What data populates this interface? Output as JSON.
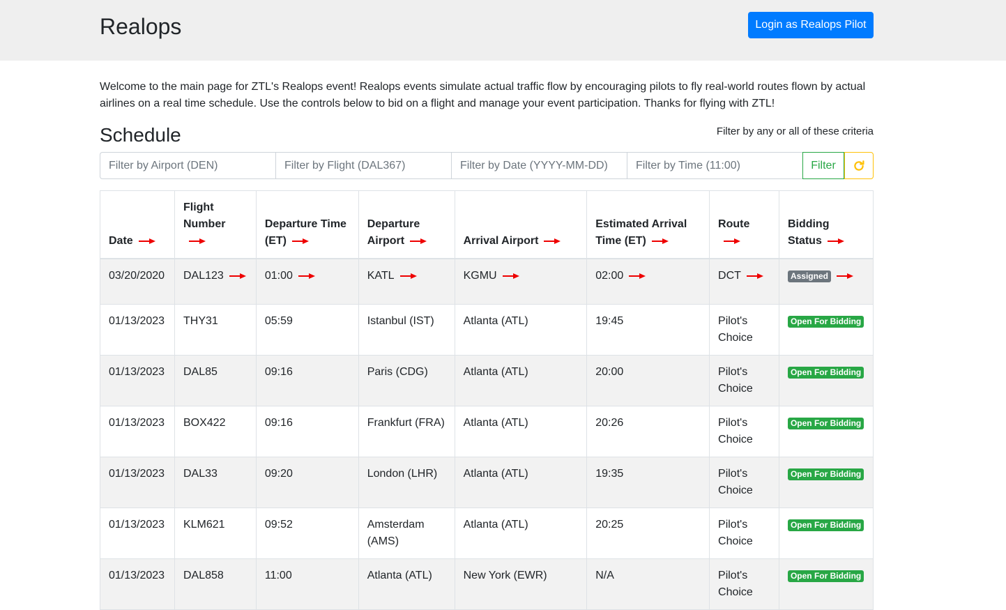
{
  "header": {
    "brand": "Realops",
    "login_button": "Login as Realops Pilot"
  },
  "intro": "Welcome to the main page for ZTL's Realops event! Realops events simulate actual traffic flow by encouraging pilots to fly real-world routes flown by actual airlines on a real time schedule. Use the controls below to bid on a flight and manage your event participation. Thanks for flying with ZTL!",
  "schedule": {
    "title": "Schedule",
    "filter_hint": "Filter by any or all of these criteria"
  },
  "filters": {
    "airport_placeholder": "Filter by Airport (DEN)",
    "flight_placeholder": "Filter by Flight (DAL367)",
    "date_placeholder": "Filter by Date (YYYY-MM-DD)",
    "time_placeholder": "Filter by Time (11:00)",
    "filter_button": "Filter",
    "reset_icon": "refresh-icon"
  },
  "table": {
    "headers": [
      "Date",
      "Flight Number",
      "Departure Time (ET)",
      "Departure Airport",
      "Arrival Airport",
      "Estimated Arrival Time (ET)",
      "Route",
      "Bidding Status"
    ],
    "rows": [
      {
        "date": "03/20/2020",
        "flight": "DAL123",
        "dep_time": "01:00",
        "dep_airport": "KATL",
        "arr_airport": "KGMU",
        "eta": "02:00",
        "route": "DCT",
        "status": "Assigned"
      },
      {
        "date": "01/13/2023",
        "flight": "THY31",
        "dep_time": "05:59",
        "dep_airport": "Istanbul (IST)",
        "arr_airport": "Atlanta (ATL)",
        "eta": "19:45",
        "route": "Pilot's Choice",
        "status": "Open For Bidding"
      },
      {
        "date": "01/13/2023",
        "flight": "DAL85",
        "dep_time": "09:16",
        "dep_airport": "Paris (CDG)",
        "arr_airport": "Atlanta (ATL)",
        "eta": "20:00",
        "route": "Pilot's Choice",
        "status": "Open For Bidding"
      },
      {
        "date": "01/13/2023",
        "flight": "BOX422",
        "dep_time": "09:16",
        "dep_airport": "Frankfurt (FRA)",
        "arr_airport": "Atlanta (ATL)",
        "eta": "20:26",
        "route": "Pilot's Choice",
        "status": "Open For Bidding"
      },
      {
        "date": "01/13/2023",
        "flight": "DAL33",
        "dep_time": "09:20",
        "dep_airport": "London (LHR)",
        "arr_airport": "Atlanta (ATL)",
        "eta": "19:35",
        "route": "Pilot's Choice",
        "status": "Open For Bidding"
      },
      {
        "date": "01/13/2023",
        "flight": "KLM621",
        "dep_time": "09:52",
        "dep_airport": "Amsterdam (AMS)",
        "arr_airport": "Atlanta (ATL)",
        "eta": "20:25",
        "route": "Pilot's Choice",
        "status": "Open For Bidding"
      },
      {
        "date": "01/13/2023",
        "flight": "DAL858",
        "dep_time": "11:00",
        "dep_airport": "Atlanta (ATL)",
        "arr_airport": "New York (EWR)",
        "eta": "N/A",
        "route": "Pilot's Choice",
        "status": "Open For Bidding"
      }
    ]
  },
  "colors": {
    "header_bg": "#efefef",
    "primary": "#007bff",
    "success": "#28a745",
    "warning": "#ffc107",
    "secondary": "#6c757d",
    "annotation_arrow": "#ee0000"
  }
}
